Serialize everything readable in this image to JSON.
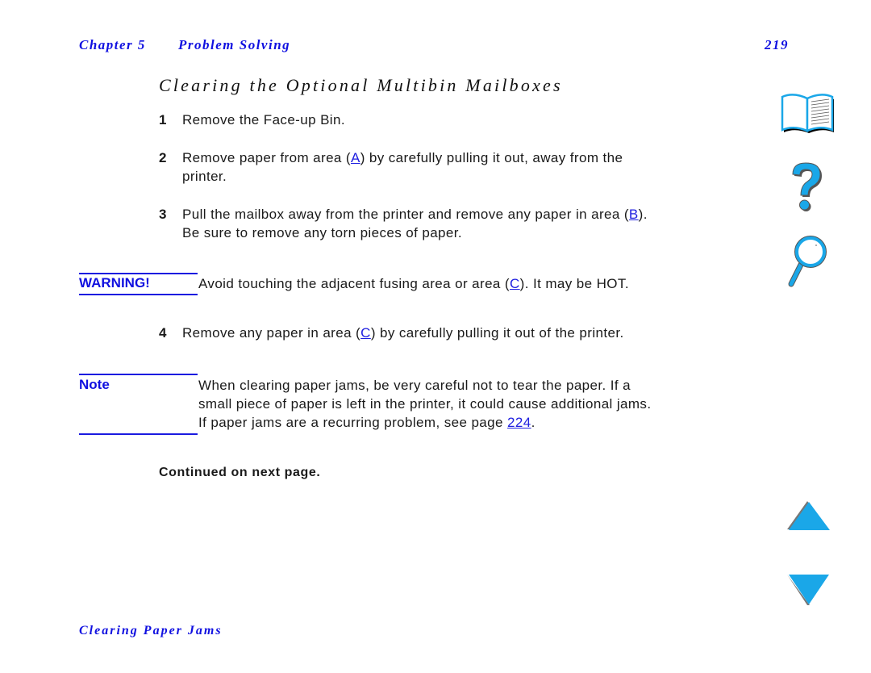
{
  "header": {
    "chapter": "Chapter 5",
    "section": "Problem Solving",
    "page_number": "219"
  },
  "title": "Clearing the Optional Multibin Mailboxes",
  "steps": [
    {
      "num": "1",
      "lines": [
        [
          "Remove the Face-up Bin."
        ]
      ]
    },
    {
      "num": "2",
      "line1_pre": "Remove paper from area (",
      "line1_link": "A",
      "line1_post": ") by carefully pulling it out, away from the",
      "line2": "printer."
    },
    {
      "num": "3",
      "line1_pre": "Pull the mailbox away from the printer and remove any paper in area (",
      "line1_link": "B",
      "line1_post": ").",
      "line2": "Be sure to remove any torn pieces of paper."
    },
    {
      "num": "4",
      "line1_pre": "Remove any paper in area (",
      "line1_link": "C",
      "line1_post": ") by carefully pulling it out of the printer."
    }
  ],
  "warning": {
    "label": "WARNING!",
    "pre": "Avoid touching the adjacent fusing area or area (",
    "link": "C",
    "post": "). It may be HOT."
  },
  "note": {
    "label": "Note",
    "line1": "When clearing paper jams, be very careful not to tear the paper. If a",
    "line2": "small piece of paper is left in the printer, it could cause additional jams.",
    "line3_pre": "If paper jams are a recurring problem, see page ",
    "line3_link": "224",
    "line3_post": "."
  },
  "continued": "Continued on next page.",
  "footer": "Clearing Paper Jams",
  "nav_icons": [
    "book-icon",
    "help-icon",
    "search-icon",
    "previous-page-icon",
    "next-page-icon"
  ],
  "colors": {
    "accent": "#1010e0",
    "icon_blue": "#1aa7e8"
  }
}
